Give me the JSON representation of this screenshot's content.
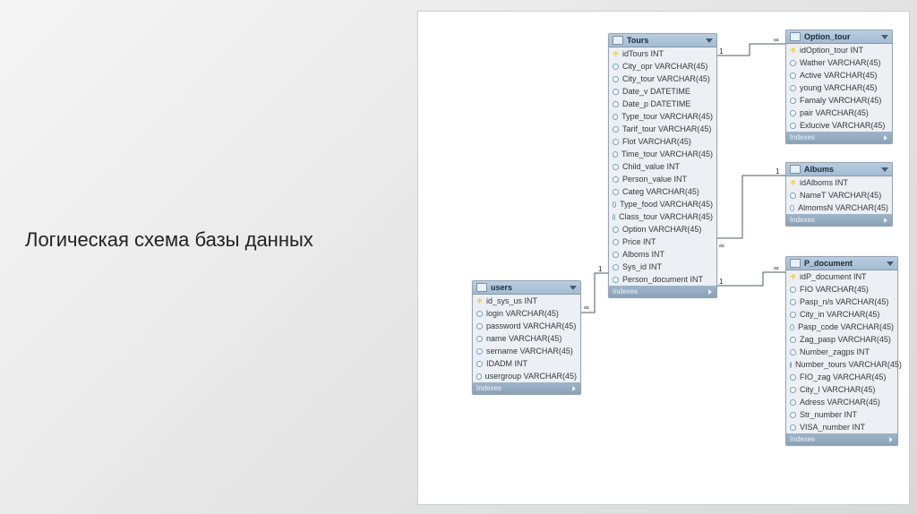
{
  "title": "Логическая схема базы данных",
  "tables": {
    "users": {
      "name": "users",
      "indexes_label": "Indexes",
      "cols": [
        {
          "n": "id_sys_us INT",
          "pk": true
        },
        {
          "n": "login VARCHAR(45)"
        },
        {
          "n": "password VARCHAR(45)"
        },
        {
          "n": "name VARCHAR(45)"
        },
        {
          "n": "sername VARCHAR(45)"
        },
        {
          "n": "IDADM INT"
        },
        {
          "n": "usergroup VARCHAR(45)"
        }
      ]
    },
    "tours": {
      "name": "Tours",
      "indexes_label": "Indexes",
      "cols": [
        {
          "n": "idTours INT",
          "pk": true
        },
        {
          "n": "City_opr VARCHAR(45)"
        },
        {
          "n": "City_tour VARCHAR(45)"
        },
        {
          "n": "Date_v DATETIME"
        },
        {
          "n": "Date_p DATETIME"
        },
        {
          "n": "Type_tour VARCHAR(45)"
        },
        {
          "n": "Tarif_tour VARCHAR(45)"
        },
        {
          "n": "Flot VARCHAR(45)"
        },
        {
          "n": "Time_tour VARCHAR(45)"
        },
        {
          "n": "Child_value INT"
        },
        {
          "n": "Person_value INT"
        },
        {
          "n": "Categ VARCHAR(45)"
        },
        {
          "n": "Type_food VARCHAR(45)"
        },
        {
          "n": "Class_tour VARCHAR(45)"
        },
        {
          "n": "Option VARCHAR(45)"
        },
        {
          "n": "Price INT"
        },
        {
          "n": "Alboms INT"
        },
        {
          "n": "Sys_id INT"
        },
        {
          "n": "Person_document INT"
        }
      ]
    },
    "option_tour": {
      "name": "Option_tour",
      "indexes_label": "Indexes",
      "cols": [
        {
          "n": "idOption_tour INT",
          "pk": true
        },
        {
          "n": "Wather VARCHAR(45)"
        },
        {
          "n": "Active VARCHAR(45)"
        },
        {
          "n": "young VARCHAR(45)"
        },
        {
          "n": "Famaly VARCHAR(45)"
        },
        {
          "n": "pair VARCHAR(45)"
        },
        {
          "n": "Exlucive VARCHAR(45)"
        }
      ]
    },
    "albums": {
      "name": "Albums",
      "indexes_label": "Indexes",
      "cols": [
        {
          "n": "idAlboms INT",
          "pk": true
        },
        {
          "n": "NameT VARCHAR(45)"
        },
        {
          "n": "AlmomsN VARCHAR(45)"
        }
      ]
    },
    "p_document": {
      "name": "P_document",
      "indexes_label": "Indexes",
      "cols": [
        {
          "n": "idP_document INT",
          "pk": true
        },
        {
          "n": "FIO VARCHAR(45)"
        },
        {
          "n": "Pasp_n/s VARCHAR(45)"
        },
        {
          "n": "City_in VARCHAR(45)"
        },
        {
          "n": "Pasp_code VARCHAR(45)"
        },
        {
          "n": "Zag_pasp VARCHAR(45)"
        },
        {
          "n": "Number_zagps INT"
        },
        {
          "n": "Number_tours VARCHAR(45)"
        },
        {
          "n": "FIO_zag VARCHAR(45)"
        },
        {
          "n": "City_l VARCHAR(45)"
        },
        {
          "n": "Adress VARCHAR(45)"
        },
        {
          "n": "Str_number INT"
        },
        {
          "n": "VISA_number INT"
        }
      ]
    }
  },
  "cardinality": {
    "one": "1",
    "many": "∞"
  }
}
